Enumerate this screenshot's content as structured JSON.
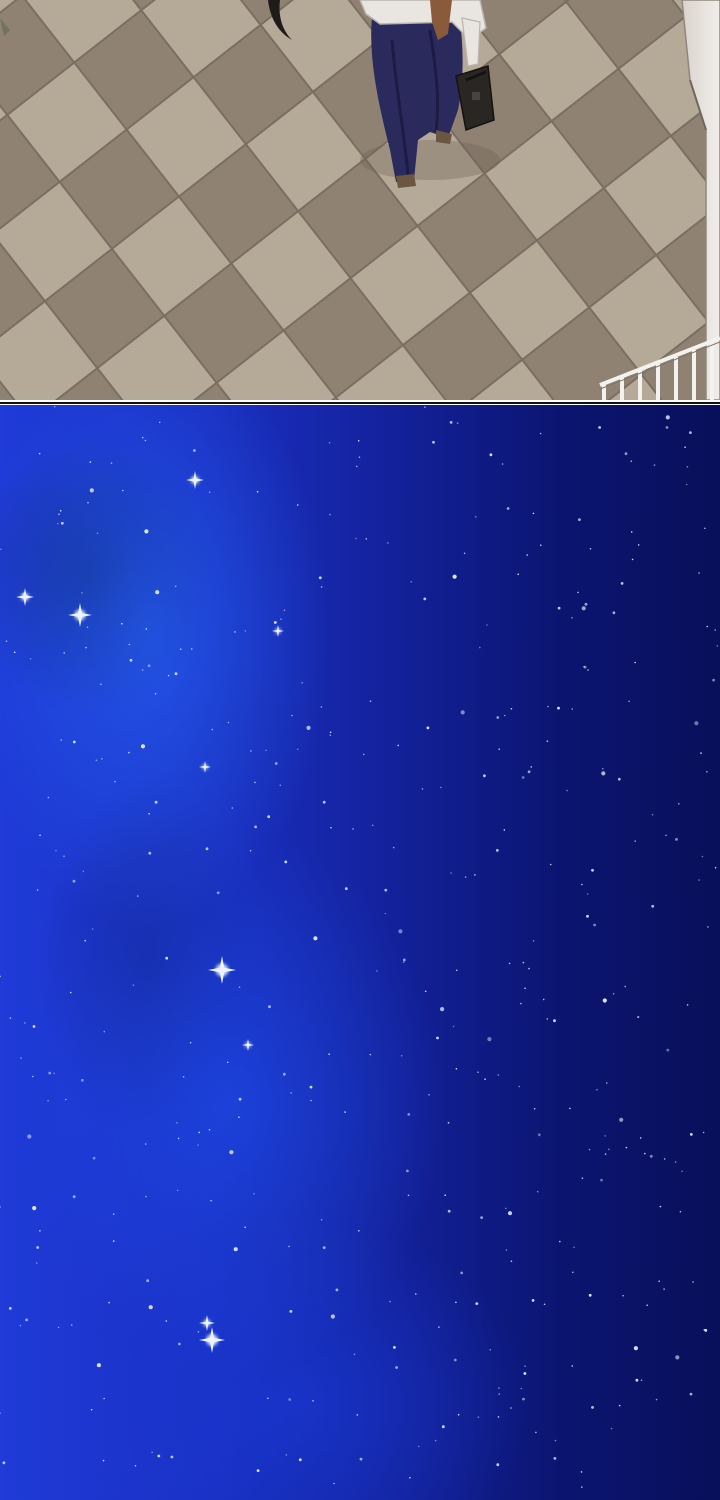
{
  "comic": {
    "panels": [
      {
        "scene": "floor-overhead",
        "colors": {
          "tile_light": "#b4a898",
          "tile_dark": "#8a7d6e",
          "trousers": "#2b2a5c",
          "shirt": "#e9e6e2",
          "bag": "#2a2623"
        }
      },
      {
        "scene": "night-sky",
        "colors": {
          "sky_bright": "#1f3bd8",
          "sky_deep": "#08105a",
          "star": "#dfe8ff"
        }
      }
    ]
  }
}
